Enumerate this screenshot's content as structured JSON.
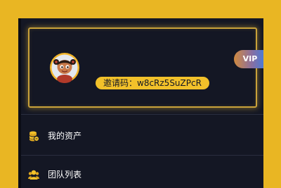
{
  "profile": {
    "invite_text": "邀请码：w8cRz5SuZPcR",
    "vip_label": "VIP",
    "avatar_icon": "cartoon-avatar"
  },
  "menu": [
    {
      "label": "我的资产",
      "icon": "coin-stack-icon"
    },
    {
      "label": "团队列表",
      "icon": "team-icon"
    }
  ],
  "colors": {
    "page_bg": "#e9b623",
    "panel_bg": "#141724",
    "accent_gold": "#f2c12a",
    "card_border": "#c9a23a"
  }
}
